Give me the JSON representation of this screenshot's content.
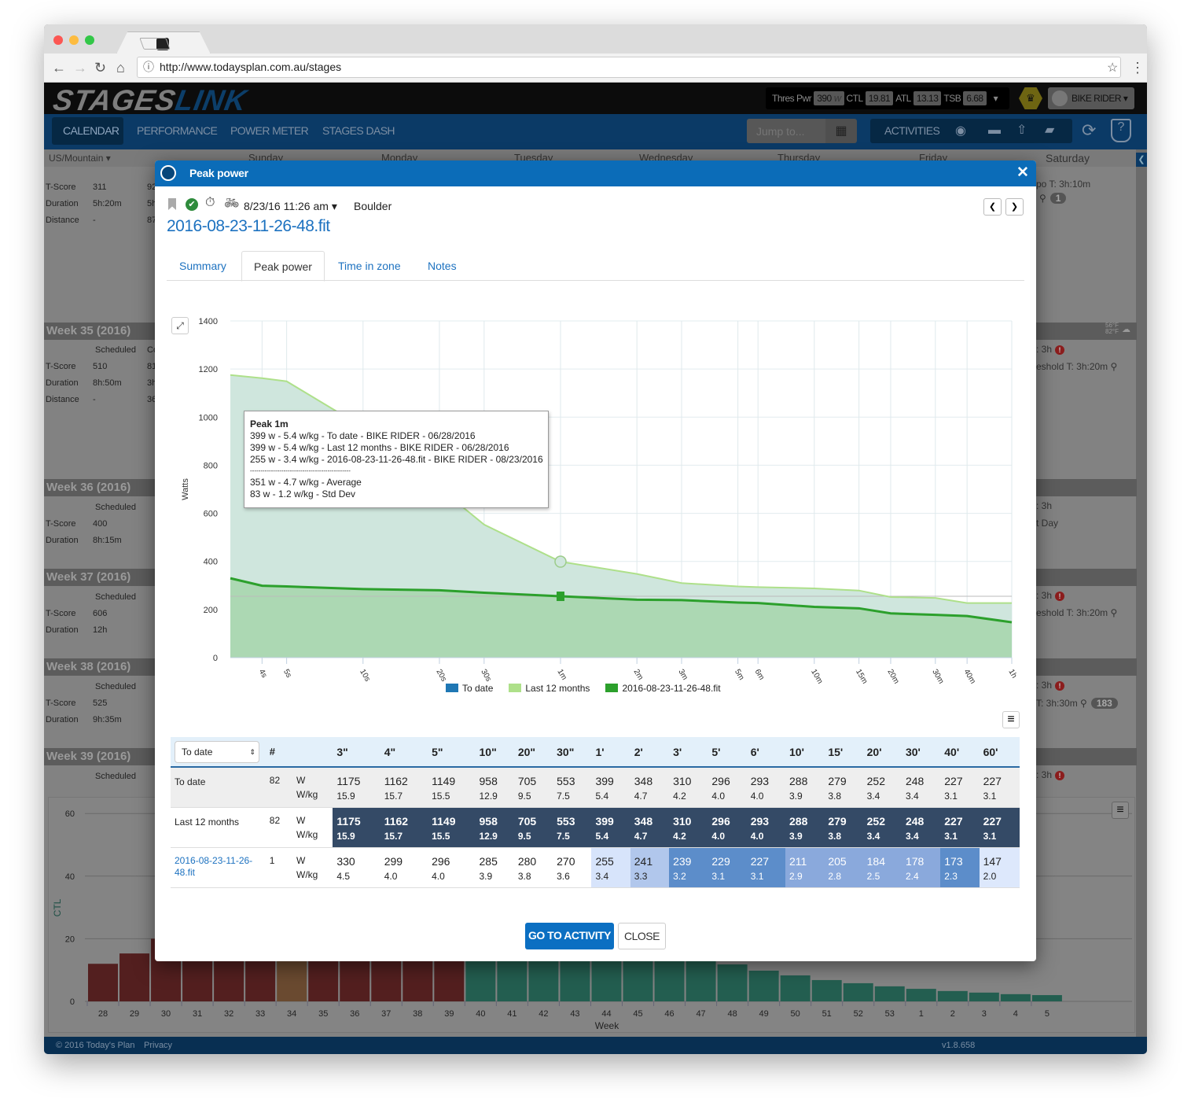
{
  "browser": {
    "url": "http://www.todaysplan.com.au/stages"
  },
  "app": {
    "logo_a": "STAGES",
    "logo_b": "LINK",
    "stats": [
      {
        "label": "Thres Pwr",
        "value": "390",
        "unit": "W"
      },
      {
        "label": "CTL",
        "value": "19.81"
      },
      {
        "label": "ATL",
        "value": "13.13"
      },
      {
        "label": "TSB",
        "value": "6.68"
      }
    ],
    "user": "BIKE RIDER",
    "nav": [
      "CALENDAR",
      "PERFORMANCE",
      "POWER METER",
      "STAGES DASH"
    ],
    "jump_placeholder": "Jump to...",
    "activities": "ACTIVITIES",
    "footer": {
      "copyright": "© 2016 Today's Plan",
      "privacy": "Privacy",
      "version": "v1.8.658"
    }
  },
  "calendar": {
    "timezone": "US/Mountain",
    "days": [
      "Sunday",
      "Monday",
      "Tuesday",
      "Wednesday",
      "Thursday",
      "Friday",
      "Saturday"
    ],
    "weeks": [
      {
        "title": "",
        "rows": [
          [
            "T-Score",
            "311",
            "92"
          ],
          [
            "Duration",
            "5h:20m",
            "5h"
          ],
          [
            "Distance",
            "-",
            "87"
          ]
        ]
      },
      {
        "title": "Week 35 (2016)",
        "sched": "Scheduled",
        "col2": "Co",
        "rows": [
          [
            "T-Score",
            "510",
            "81"
          ],
          [
            "Duration",
            "8h:50m",
            "3h"
          ],
          [
            "Distance",
            "-",
            "36"
          ]
        ]
      },
      {
        "title": "Week 36 (2016)",
        "sched": "Scheduled",
        "rows": [
          [
            "T-Score",
            "400"
          ],
          [
            "Duration",
            "8h:15m"
          ]
        ]
      },
      {
        "title": "Week 37 (2016)",
        "sched": "Scheduled",
        "rows": [
          [
            "T-Score",
            "606"
          ],
          [
            "Duration",
            "12h"
          ]
        ]
      },
      {
        "title": "Week 38 (2016)",
        "sched": "Scheduled",
        "rows": [
          [
            "T-Score",
            "525"
          ],
          [
            "Duration",
            "9h:35m"
          ]
        ]
      },
      {
        "title": "Week 39 (2016)",
        "sched": "Scheduled",
        "rows": []
      }
    ],
    "saturday": [
      {
        "text": "po  T: 3h:10m",
        "badge": "1"
      },
      {
        "text": ": 3h",
        "alert": true
      },
      {
        "text": "eshold  T: 3h:20m"
      },
      {
        "text": ": 3h"
      },
      {
        "text": "t Day"
      },
      {
        "text": ": 3h",
        "alert": true
      },
      {
        "text": "eshold  T: 3h:20m"
      },
      {
        "text": ": 3h",
        "alert": true
      },
      {
        "text": "T: 3h:30m",
        "badge": "183"
      },
      {
        "text": ": 3h",
        "alert": true
      }
    ],
    "weather": {
      "low": "56°F",
      "high": "82°F"
    }
  },
  "ctl_chart": {
    "ylabel": "CTL",
    "xlabel": "Week",
    "yticks": [
      0,
      20,
      40,
      60
    ],
    "weeks": [
      "28",
      "29",
      "30",
      "31",
      "32",
      "33",
      "34",
      "35",
      "36",
      "37",
      "38",
      "39",
      "40",
      "41",
      "42",
      "43",
      "44",
      "45",
      "46",
      "47",
      "48",
      "49",
      "50",
      "51",
      "52",
      "53",
      "1",
      "2",
      "3",
      "4",
      "5"
    ],
    "values": [
      12,
      15.3,
      null,
      null,
      null,
      null,
      null,
      null,
      null,
      null,
      null,
      null,
      null,
      null,
      null,
      null,
      null,
      null,
      null,
      null,
      11.8,
      9.8,
      8.3,
      6.8,
      5.8,
      4.8,
      4,
      3.3,
      2.8,
      2.3,
      2
    ],
    "colors": {
      "past": "#8b2c2c",
      "current": "#c8844a",
      "future": "#2c8a6c"
    }
  },
  "modal": {
    "title": "Peak power",
    "date": "8/23/16 11:26 am",
    "location": "Boulder",
    "filename": "2016-08-23-11-26-48.fit",
    "tabs": [
      "Summary",
      "Peak power",
      "Time in zone",
      "Notes"
    ],
    "active_tab": "Peak power",
    "go_button": "GO TO ACTIVITY",
    "close_button": "CLOSE",
    "tooltip": {
      "title": "Peak 1m",
      "lines": [
        "399 w - 5.4 w/kg - To date - BIKE RIDER - 06/28/2016",
        "399 w - 5.4 w/kg - Last 12 months - BIKE RIDER - 06/28/2016",
        "255 w - 3.4 w/kg - 2016-08-23-11-26-48.fit - BIKE RIDER - 08/23/2016"
      ],
      "separator": "------------------------------------------------",
      "stats": [
        "351 w - 4.7 w/kg - Average",
        "83 w - 1.2 w/kg - Std Dev"
      ]
    },
    "table": {
      "selector": "To date",
      "hash": "#",
      "headers": [
        "3\"",
        "4\"",
        "5\"",
        "10\"",
        "20\"",
        "30\"",
        "1'",
        "2'",
        "3'",
        "5'",
        "6'",
        "10'",
        "15'",
        "20'",
        "30'",
        "40'",
        "60'"
      ],
      "rows": [
        {
          "label": "To date",
          "count": "82",
          "w": [
            "1175",
            "1162",
            "1149",
            "958",
            "705",
            "553",
            "399",
            "348",
            "310",
            "296",
            "293",
            "288",
            "279",
            "252",
            "248",
            "227",
            "227"
          ],
          "wkg": [
            "15.9",
            "15.7",
            "15.5",
            "12.9",
            "9.5",
            "7.5",
            "5.4",
            "4.7",
            "4.2",
            "4.0",
            "4.0",
            "3.9",
            "3.8",
            "3.4",
            "3.4",
            "3.1",
            "3.1"
          ]
        },
        {
          "label": "Last 12 months",
          "count": "82",
          "w": [
            "1175",
            "1162",
            "1149",
            "958",
            "705",
            "553",
            "399",
            "348",
            "310",
            "296",
            "293",
            "288",
            "279",
            "252",
            "248",
            "227",
            "227"
          ],
          "wkg": [
            "15.9",
            "15.7",
            "15.5",
            "12.9",
            "9.5",
            "7.5",
            "5.4",
            "4.7",
            "4.2",
            "4.0",
            "4.0",
            "3.9",
            "3.8",
            "3.4",
            "3.4",
            "3.1",
            "3.1"
          ]
        },
        {
          "label": "2016-08-23-11-26-48.fit",
          "count": "1",
          "w": [
            "330",
            "299",
            "296",
            "285",
            "280",
            "270",
            "255",
            "241",
            "239",
            "229",
            "227",
            "211",
            "205",
            "184",
            "178",
            "173",
            "147"
          ],
          "wkg": [
            "4.5",
            "4.0",
            "4.0",
            "3.9",
            "3.8",
            "3.6",
            "3.4",
            "3.3",
            "3.2",
            "3.1",
            "3.1",
            "2.9",
            "2.8",
            "2.5",
            "2.4",
            "2.3",
            "2.0"
          ],
          "cell_colors": [
            null,
            null,
            null,
            null,
            null,
            null,
            "#d7e4fb",
            "#b1c7ec",
            "#5c8dca",
            "#5c8dca",
            "#5c8dca",
            "#8aa9dc",
            "#8aa9dc",
            "#8aa9dc",
            "#8aa9dc",
            "#5c8dca",
            "#dde8fc"
          ]
        }
      ],
      "units": [
        "W",
        "W/kg"
      ]
    }
  },
  "chart_data": {
    "type": "area",
    "ylabel": "Watts",
    "ylim": [
      0,
      1400
    ],
    "yticks": [
      0,
      200,
      400,
      600,
      800,
      1000,
      1200,
      1400
    ],
    "x_scale": "log",
    "grid": true,
    "legend_placement": "bottom",
    "x_seconds": [
      3,
      4,
      5,
      10,
      20,
      30,
      60,
      120,
      180,
      300,
      360,
      600,
      900,
      1200,
      1800,
      2400,
      3600
    ],
    "xticks": [
      {
        "s": 4,
        "label": "4s"
      },
      {
        "s": 5,
        "label": "5s"
      },
      {
        "s": 10,
        "label": "10s"
      },
      {
        "s": 20,
        "label": "20s"
      },
      {
        "s": 30,
        "label": "30s"
      },
      {
        "s": 60,
        "label": "1m"
      },
      {
        "s": 120,
        "label": "2m"
      },
      {
        "s": 180,
        "label": "3m"
      },
      {
        "s": 300,
        "label": "5m"
      },
      {
        "s": 360,
        "label": "6m"
      },
      {
        "s": 600,
        "label": "10m"
      },
      {
        "s": 900,
        "label": "15m"
      },
      {
        "s": 1200,
        "label": "20m"
      },
      {
        "s": 1800,
        "label": "30m"
      },
      {
        "s": 2400,
        "label": "40m"
      },
      {
        "s": 3600,
        "label": "1h"
      }
    ],
    "series": [
      {
        "name": "To date",
        "color": "#1f77b4",
        "values": [
          1175,
          1162,
          1149,
          958,
          705,
          553,
          399,
          348,
          310,
          296,
          293,
          288,
          279,
          252,
          248,
          227,
          227
        ]
      },
      {
        "name": "Last 12 months",
        "color": "#aee08a",
        "values": [
          1175,
          1162,
          1149,
          958,
          705,
          553,
          399,
          348,
          310,
          296,
          293,
          288,
          279,
          252,
          248,
          227,
          227
        ]
      },
      {
        "name": "2016-08-23-11-26-48.fit",
        "color": "#2ca02c",
        "values": [
          330,
          299,
          296,
          285,
          280,
          270,
          255,
          241,
          239,
          229,
          227,
          211,
          205,
          184,
          178,
          173,
          147
        ]
      }
    ],
    "highlight_seconds": 60
  }
}
